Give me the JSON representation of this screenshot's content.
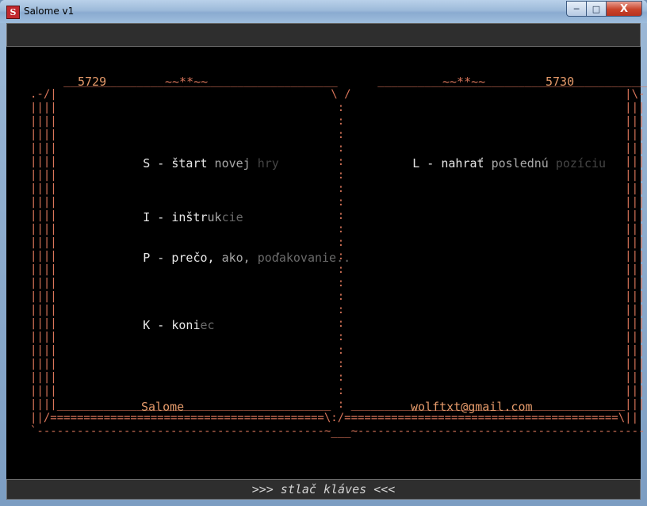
{
  "window": {
    "title": "Salome v1",
    "icon_letter": "S",
    "minimize": "─",
    "maximize": "□",
    "close": "X"
  },
  "book": {
    "left_page_number": "5729",
    "right_page_number": "5730",
    "ornament": "~~**~~",
    "left_footer": "Salome",
    "right_footer": "wolftxt@gmail.com"
  },
  "menu": {
    "start": {
      "key": "S - ",
      "a": "štart",
      "b": " novej",
      "c": " hry"
    },
    "instructions": {
      "key": "I - ",
      "a": "inštr",
      "b": "uk",
      "c": "cie"
    },
    "about": {
      "key": "P - ",
      "a": "prečo,",
      "b": " ako,",
      "c": " poďakovanie..",
      "d": ""
    },
    "quit": {
      "key": "K - ",
      "a": "koni",
      "b": "ec"
    },
    "load": {
      "key": "L - ",
      "a": "nahrať",
      "b": " poslednú",
      "c": " pozíciu"
    }
  },
  "status": {
    "prompt": ">>> stlač kláves <<<"
  }
}
